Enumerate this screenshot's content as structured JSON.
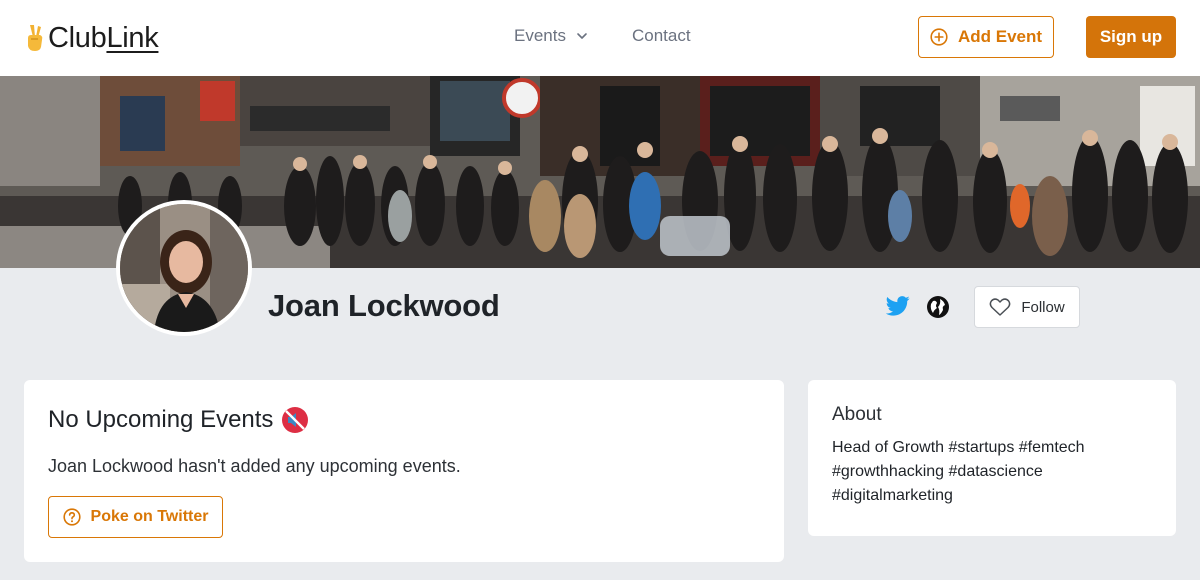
{
  "brand": {
    "name_prefix": "Club",
    "name_suffix": "Link",
    "icon": "victory-hand-icon"
  },
  "nav": {
    "events_label": "Events",
    "contact_label": "Contact",
    "add_event_label": "Add Event",
    "signup_label": "Sign up"
  },
  "profile": {
    "name": "Joan Lockwood",
    "follow_label": "Follow",
    "social_icons": [
      "twitter-icon",
      "globe-icon"
    ]
  },
  "events": {
    "title": "No Upcoming Events",
    "title_icon": "muted-speaker-icon",
    "message": "Joan Lockwood hasn't added any upcoming events.",
    "poke_label": "Poke on Twitter"
  },
  "about": {
    "title": "About",
    "text": "Head of Growth #startups #femtech #growthhacking #datascience #digitalmarketing"
  },
  "colors": {
    "accent": "#d97706",
    "page_background": "#e9ebee",
    "twitter": "#1da1f2"
  }
}
